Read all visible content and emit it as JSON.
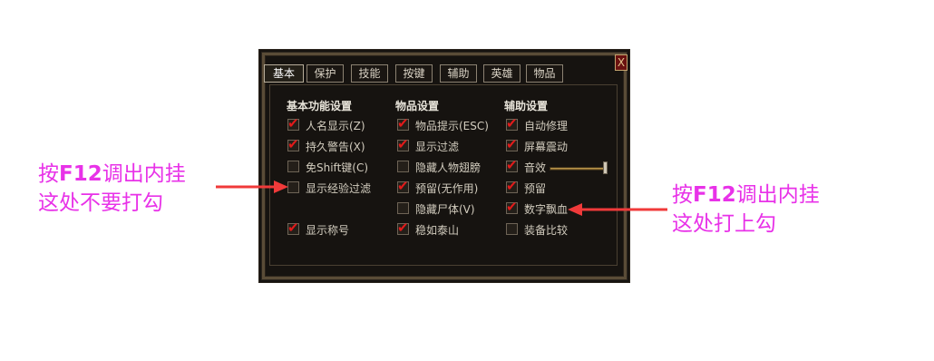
{
  "window": {
    "close_label": "X"
  },
  "tabs": [
    "基本",
    "保护",
    "技能",
    "按键",
    "辅助",
    "英雄",
    "物品"
  ],
  "active_tab": "基本",
  "columns": {
    "basic": {
      "title": "基本功能设置",
      "items": [
        {
          "label": "人名显示(Z)",
          "checked": true
        },
        {
          "label": "持久警告(X)",
          "checked": true
        },
        {
          "label": "免Shift键(C)",
          "checked": false
        },
        {
          "label": "显示经验过滤",
          "checked": false
        },
        {
          "label": "显示称号",
          "checked": true
        }
      ]
    },
    "items": {
      "title": "物品设置",
      "items": [
        {
          "label": "物品提示(ESC)",
          "checked": true
        },
        {
          "label": "显示过滤",
          "checked": true
        },
        {
          "label": "隐藏人物翅膀",
          "checked": false
        },
        {
          "label": "预留(无作用)",
          "checked": true
        },
        {
          "label": "隐藏尸体(V)",
          "checked": false
        },
        {
          "label": "稳如泰山",
          "checked": true
        }
      ]
    },
    "assist": {
      "title": "辅助设置",
      "items": [
        {
          "label": "自动修理",
          "checked": true
        },
        {
          "label": "屏幕震动",
          "checked": true
        },
        {
          "label": "音效",
          "checked": true
        },
        {
          "label": "预留",
          "checked": true
        },
        {
          "label": "数字飘血",
          "checked": true
        },
        {
          "label": "装备比较",
          "checked": false
        }
      ]
    }
  },
  "sound_slider": {
    "level": 1.0
  },
  "annotations": {
    "left": {
      "line1_prefix": "按",
      "line1_key": "F12",
      "line1_suffix": "调出内挂",
      "line2": "这处不要打勾"
    },
    "right": {
      "line1_prefix": "按",
      "line1_key": "F12",
      "line1_suffix": "调出内挂",
      "line2": "这处打上勾"
    }
  },
  "colors": {
    "annotation": "#e832e8",
    "arrow": "#f03a3a",
    "checkmark": "#e21a1a"
  }
}
